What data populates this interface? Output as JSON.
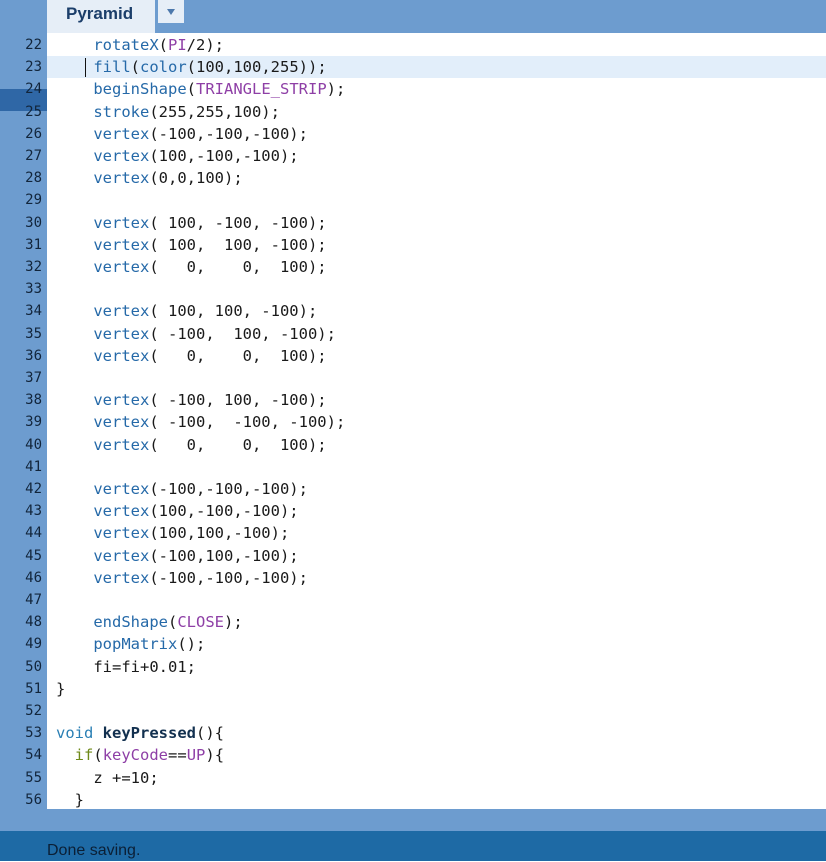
{
  "tab": {
    "label": "Pyramid",
    "menu_icon": "dropdown-arrow-icon"
  },
  "editor": {
    "current_line": "23",
    "lines": [
      {
        "n": "22",
        "tokens": [
          [
            "",
            "    "
          ],
          [
            "fn",
            "rotateX"
          ],
          [
            "",
            "("
          ],
          [
            "const",
            "PI"
          ],
          [
            "",
            "/2);"
          ]
        ]
      },
      {
        "n": "23",
        "tokens": [
          [
            "",
            "    "
          ],
          [
            "fn",
            "fill"
          ],
          [
            "",
            "("
          ],
          [
            "fn",
            "color"
          ],
          [
            "",
            "(100,100,255));"
          ]
        ]
      },
      {
        "n": "24",
        "tokens": [
          [
            "",
            "    "
          ],
          [
            "fn",
            "beginShape"
          ],
          [
            "",
            "("
          ],
          [
            "const",
            "TRIANGLE_STRIP"
          ],
          [
            "",
            ");"
          ]
        ]
      },
      {
        "n": "25",
        "tokens": [
          [
            "",
            "    "
          ],
          [
            "fn",
            "stroke"
          ],
          [
            "",
            "(255,255,100);"
          ]
        ]
      },
      {
        "n": "26",
        "tokens": [
          [
            "",
            "    "
          ],
          [
            "fn",
            "vertex"
          ],
          [
            "",
            "(-100,-100,-100);"
          ]
        ]
      },
      {
        "n": "27",
        "tokens": [
          [
            "",
            "    "
          ],
          [
            "fn",
            "vertex"
          ],
          [
            "",
            "(100,-100,-100);"
          ]
        ]
      },
      {
        "n": "28",
        "tokens": [
          [
            "",
            "    "
          ],
          [
            "fn",
            "vertex"
          ],
          [
            "",
            "(0,0,100);"
          ]
        ]
      },
      {
        "n": "29",
        "tokens": []
      },
      {
        "n": "30",
        "tokens": [
          [
            "",
            "    "
          ],
          [
            "fn",
            "vertex"
          ],
          [
            "",
            "( 100, -100, -100);"
          ]
        ]
      },
      {
        "n": "31",
        "tokens": [
          [
            "",
            "    "
          ],
          [
            "fn",
            "vertex"
          ],
          [
            "",
            "( 100,  100, -100);"
          ]
        ]
      },
      {
        "n": "32",
        "tokens": [
          [
            "",
            "    "
          ],
          [
            "fn",
            "vertex"
          ],
          [
            "",
            "(   0,    0,  100);"
          ]
        ]
      },
      {
        "n": "33",
        "tokens": []
      },
      {
        "n": "34",
        "tokens": [
          [
            "",
            "    "
          ],
          [
            "fn",
            "vertex"
          ],
          [
            "",
            "( 100, 100, -100);"
          ]
        ]
      },
      {
        "n": "35",
        "tokens": [
          [
            "",
            "    "
          ],
          [
            "fn",
            "vertex"
          ],
          [
            "",
            "( -100,  100, -100);"
          ]
        ]
      },
      {
        "n": "36",
        "tokens": [
          [
            "",
            "    "
          ],
          [
            "fn",
            "vertex"
          ],
          [
            "",
            "(   0,    0,  100);"
          ]
        ]
      },
      {
        "n": "37",
        "tokens": []
      },
      {
        "n": "38",
        "tokens": [
          [
            "",
            "    "
          ],
          [
            "fn",
            "vertex"
          ],
          [
            "",
            "( -100, 100, -100);"
          ]
        ]
      },
      {
        "n": "39",
        "tokens": [
          [
            "",
            "    "
          ],
          [
            "fn",
            "vertex"
          ],
          [
            "",
            "( -100,  -100, -100);"
          ]
        ]
      },
      {
        "n": "40",
        "tokens": [
          [
            "",
            "    "
          ],
          [
            "fn",
            "vertex"
          ],
          [
            "",
            "(   0,    0,  100);"
          ]
        ]
      },
      {
        "n": "41",
        "tokens": []
      },
      {
        "n": "42",
        "tokens": [
          [
            "",
            "    "
          ],
          [
            "fn",
            "vertex"
          ],
          [
            "",
            "(-100,-100,-100);"
          ]
        ]
      },
      {
        "n": "43",
        "tokens": [
          [
            "",
            "    "
          ],
          [
            "fn",
            "vertex"
          ],
          [
            "",
            "(100,-100,-100);"
          ]
        ]
      },
      {
        "n": "44",
        "tokens": [
          [
            "",
            "    "
          ],
          [
            "fn",
            "vertex"
          ],
          [
            "",
            "(100,100,-100);"
          ]
        ]
      },
      {
        "n": "45",
        "tokens": [
          [
            "",
            "    "
          ],
          [
            "fn",
            "vertex"
          ],
          [
            "",
            "(-100,100,-100);"
          ]
        ]
      },
      {
        "n": "46",
        "tokens": [
          [
            "",
            "    "
          ],
          [
            "fn",
            "vertex"
          ],
          [
            "",
            "(-100,-100,-100);"
          ]
        ]
      },
      {
        "n": "47",
        "tokens": []
      },
      {
        "n": "48",
        "tokens": [
          [
            "",
            "    "
          ],
          [
            "fn",
            "endShape"
          ],
          [
            "",
            "("
          ],
          [
            "const",
            "CLOSE"
          ],
          [
            "",
            ");"
          ]
        ]
      },
      {
        "n": "49",
        "tokens": [
          [
            "",
            "    "
          ],
          [
            "fn",
            "popMatrix"
          ],
          [
            "",
            "();"
          ]
        ]
      },
      {
        "n": "50",
        "tokens": [
          [
            "",
            "    fi=fi+0.01;"
          ]
        ]
      },
      {
        "n": "51",
        "tokens": [
          [
            "",
            "}"
          ]
        ]
      },
      {
        "n": "52",
        "tokens": []
      },
      {
        "n": "53",
        "tokens": [
          [
            "kw",
            "void"
          ],
          [
            "",
            " "
          ],
          [
            "bold",
            "keyPressed"
          ],
          [
            "",
            "(){"
          ]
        ]
      },
      {
        "n": "54",
        "tokens": [
          [
            "",
            "  "
          ],
          [
            "ctrl",
            "if"
          ],
          [
            "",
            "("
          ],
          [
            "const",
            "keyCode"
          ],
          [
            "",
            "=="
          ],
          [
            "const",
            "UP"
          ],
          [
            "",
            "){"
          ]
        ]
      },
      {
        "n": "55",
        "tokens": [
          [
            "",
            "    z +=10;"
          ]
        ]
      },
      {
        "n": "56",
        "tokens": [
          [
            "",
            "  }"
          ]
        ]
      }
    ]
  },
  "status": {
    "message": "Done saving."
  }
}
